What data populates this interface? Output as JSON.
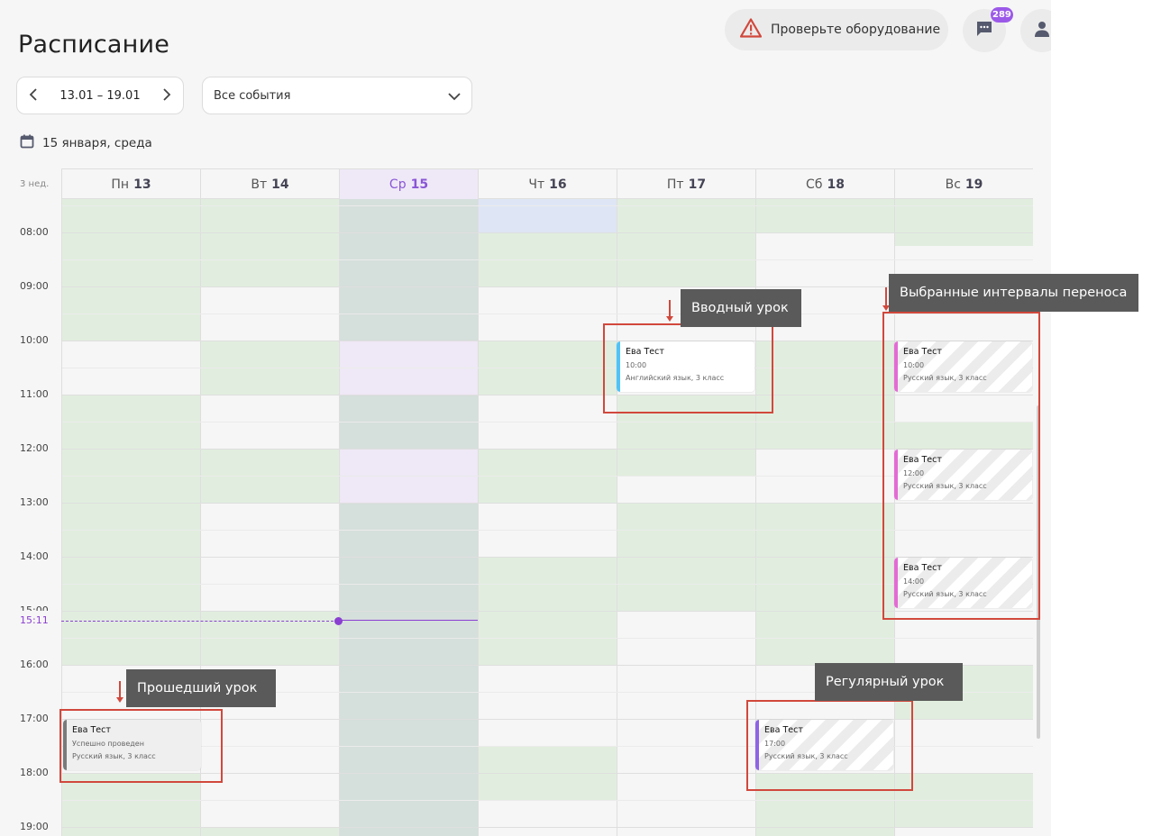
{
  "header": {
    "title": "Расписание",
    "equipment_warning": "Проверьте оборудование",
    "messages_badge": "289"
  },
  "toolbar": {
    "date_range": "13.01 – 19.01",
    "filter_value": "Все события",
    "today": "15 января, среда"
  },
  "calendar": {
    "week_label": "3 нед.",
    "days": [
      {
        "dow": "Пн",
        "num": "13"
      },
      {
        "dow": "Вт",
        "num": "14"
      },
      {
        "dow": "Ср",
        "num": "15",
        "today": true
      },
      {
        "dow": "Чт",
        "num": "16"
      },
      {
        "dow": "Пт",
        "num": "17"
      },
      {
        "dow": "Сб",
        "num": "18"
      },
      {
        "dow": "Вс",
        "num": "19"
      }
    ],
    "times": [
      "08:00",
      "09:00",
      "10:00",
      "11:00",
      "12:00",
      "13:00",
      "14:00",
      "15:00",
      "16:00",
      "17:00",
      "18:00",
      "19:00"
    ],
    "now_time": "15:11",
    "events": {
      "intro": {
        "name": "Ева Тест",
        "time": "10:00",
        "subject": "Английский язык, 3 класс"
      },
      "sun1": {
        "name": "Ева Тест",
        "time": "10:00",
        "subject": "Русский язык, 3 класс"
      },
      "sun2": {
        "name": "Ева Тест",
        "time": "12:00",
        "subject": "Русский язык, 3 класс"
      },
      "sun3": {
        "name": "Ева Тест",
        "time": "14:00",
        "subject": "Русский язык, 3 класс"
      },
      "regular": {
        "name": "Ева Тест",
        "time": "17:00",
        "subject": "Русский язык, 3 класс"
      },
      "past": {
        "name": "Ева Тест",
        "status": "Успешно проведен",
        "subject": "Русский язык, 3 класс"
      }
    }
  },
  "annotations": {
    "intro": "Вводный урок",
    "transfer": "Выбранные интервалы переноса",
    "past": "Прошедший урок",
    "regular": "Регулярный урок"
  },
  "colors": {
    "accent_purple": "#8a56d6",
    "intro_accent": "#4fc3f7",
    "transfer_accent": "#e36bd4",
    "regular_accent": "#8e63e6",
    "past_accent": "#7a7a7a",
    "annotation_red": "#d1483c",
    "available_slot": "#e1eedf"
  },
  "icons": [
    "warning-icon",
    "chat-icon",
    "user-icon",
    "chevron-left-icon",
    "chevron-right-icon",
    "chevron-down-icon",
    "calendar-icon"
  ]
}
